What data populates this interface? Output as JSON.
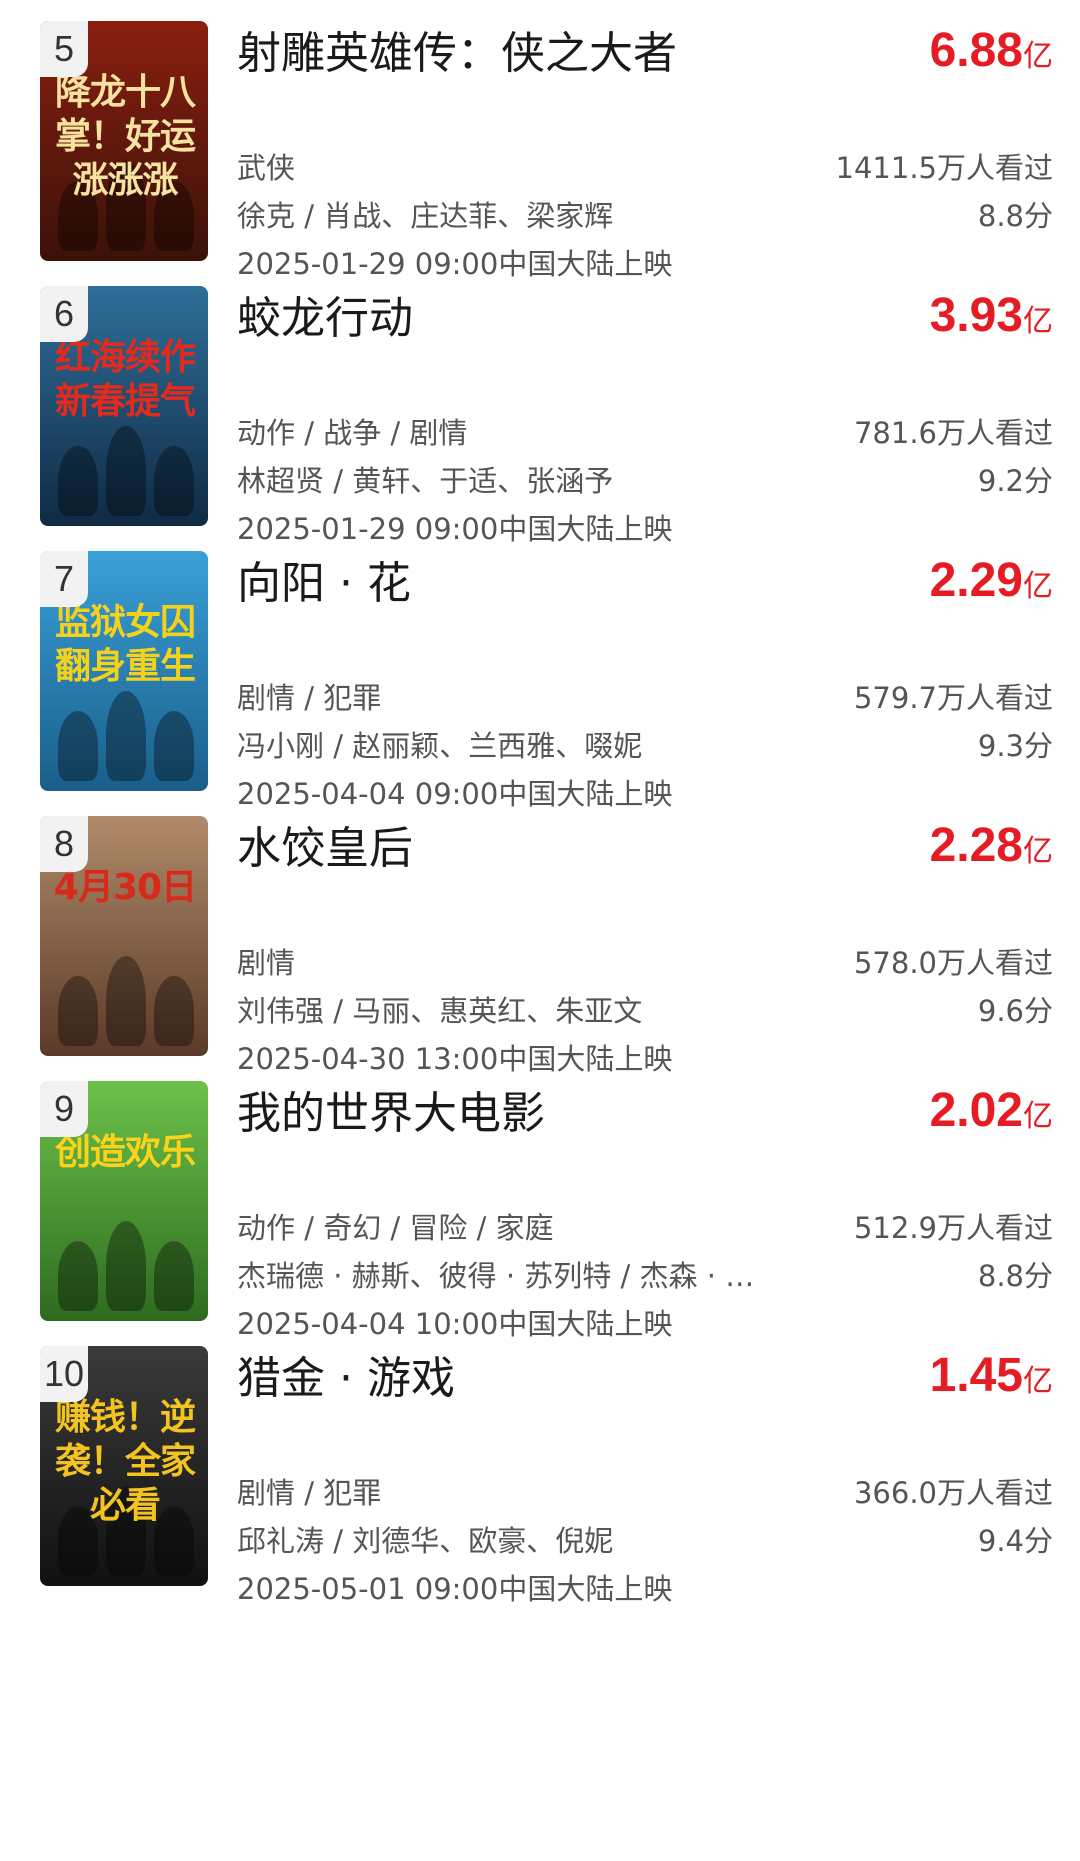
{
  "movies": [
    {
      "rank": "5",
      "title": "射雕英雄传：侠之大者",
      "gross": "6.88",
      "unit": "亿",
      "genre": "武侠",
      "crew": "徐克 / 肖战、庄达菲、梁家辉",
      "date": "2025-01-29 09:00中国大陆上映",
      "viewers": "1411.5万人看过",
      "score": "8.8分",
      "poster_text": "降龙十八掌！好运涨涨涨",
      "poster_colors": [
        "#8a1f10",
        "#3a1208"
      ],
      "poster_text_color": "#f7e3a0"
    },
    {
      "rank": "6",
      "title": "蛟龙行动",
      "gross": "3.93",
      "unit": "亿",
      "genre": "动作 / 战争 / 剧情",
      "crew": "林超贤 / 黄轩、于适、张涵予",
      "date": "2025-01-29 09:00中国大陆上映",
      "viewers": "781.6万人看过",
      "score": "9.2分",
      "poster_text": "红海续作新春提气",
      "poster_colors": [
        "#2f6f9a",
        "#0f2a44"
      ],
      "poster_text_color": "#e32a1c"
    },
    {
      "rank": "7",
      "title": "向阳 · 花",
      "gross": "2.29",
      "unit": "亿",
      "genre": "剧情 / 犯罪",
      "crew": "冯小刚 / 赵丽颖、兰西雅、啜妮",
      "date": "2025-04-04 09:00中国大陆上映",
      "viewers": "579.7万人看过",
      "score": "9.3分",
      "poster_text": "监狱女囚翻身重生",
      "poster_colors": [
        "#3aa0d8",
        "#1a5e8a"
      ],
      "poster_text_color": "#f5d21a"
    },
    {
      "rank": "8",
      "title": "水饺皇后",
      "gross": "2.28",
      "unit": "亿",
      "genre": "剧情",
      "crew": "刘伟强 / 马丽、惠英红、朱亚文",
      "date": "2025-04-30 13:00中国大陆上映",
      "viewers": "578.0万人看过",
      "score": "9.6分",
      "poster_text": "4月30日",
      "poster_colors": [
        "#b08a6a",
        "#5a3a28"
      ],
      "poster_text_color": "#d82a1a"
    },
    {
      "rank": "9",
      "title": "我的世界大电影",
      "gross": "2.02",
      "unit": "亿",
      "genre": "动作 / 奇幻 / 冒险 / 家庭",
      "crew": "杰瑞德 · 赫斯、彼得 · 苏列特 / 杰森 · 莫玛",
      "date": "2025-04-04 10:00中国大陆上映",
      "viewers": "512.9万人看过",
      "score": "8.8分",
      "poster_text": "创造欢乐",
      "poster_colors": [
        "#6cc24a",
        "#2d6a1f"
      ],
      "poster_text_color": "#ffd21a"
    },
    {
      "rank": "10",
      "title": "猎金 · 游戏",
      "gross": "1.45",
      "unit": "亿",
      "genre": "剧情 / 犯罪",
      "crew": "邱礼涛 / 刘德华、欧豪、倪妮",
      "date": "2025-05-01 09:00中国大陆上映",
      "viewers": "366.0万人看过",
      "score": "9.4分",
      "poster_text": "赚钱！逆袭！全家必看",
      "poster_colors": [
        "#3a3a3a",
        "#111111"
      ],
      "poster_text_color": "#f3c420"
    }
  ]
}
